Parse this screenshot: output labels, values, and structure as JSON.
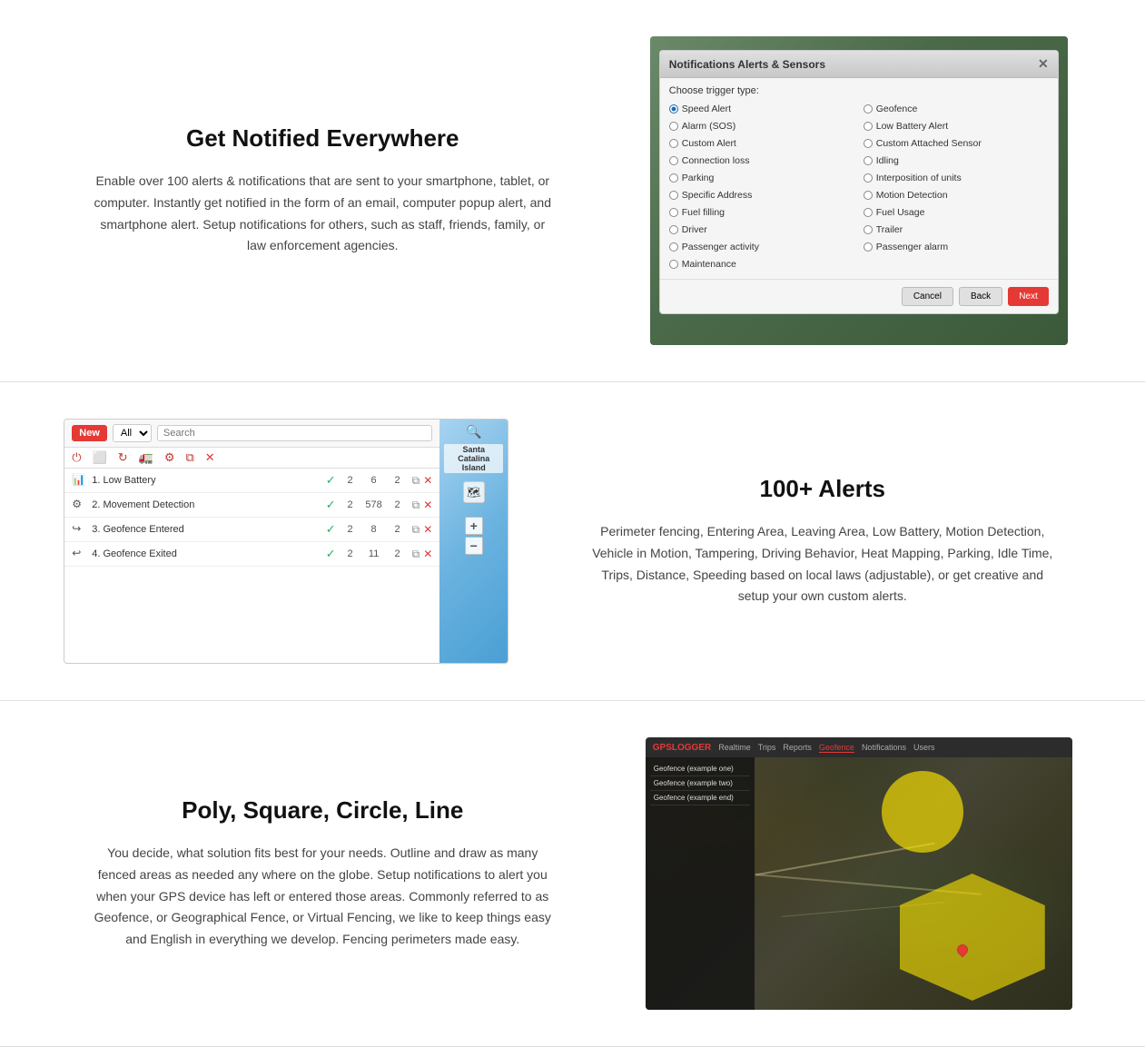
{
  "sections": [
    {
      "id": "notifications",
      "heading": "Get Notified Everywhere",
      "body": "Enable over 100 alerts & notifications that are sent to your smartphone, tablet, or computer. Instantly get notified in the form of an email, computer popup alert, and smartphone alert. Setup notifications for others, such as staff, friends, family, or law enforcement agencies.",
      "dialog": {
        "title": "Notifications Alerts & Sensors",
        "trigger_label": "Choose trigger type:",
        "options_left": [
          "Speed Alert",
          "Alarm (SOS)",
          "Custom Alert",
          "Connection loss",
          "Parking",
          "Specific Address",
          "Fuel filling",
          "Driver",
          "Passenger activity",
          "Maintenance"
        ],
        "options_right": [
          "Geofence",
          "Low Battery Alert",
          "Custom Attached Sensor",
          "Idling",
          "Interposition of units",
          "Motion Detection",
          "Fuel Usage",
          "Trailer",
          "Passenger alarm"
        ],
        "selected": "Speed Alert",
        "buttons": [
          "Cancel",
          "Back",
          "Next"
        ]
      }
    },
    {
      "id": "alerts",
      "heading": "100+ Alerts",
      "body": "Perimeter fencing, Entering Area, Leaving Area, Low Battery, Motion Detection, Vehicle in Motion, Tampering, Driving Behavior, Heat Mapping, Parking, Idle Time, Trips, Distance, Speeding based on local laws (adjustable), or get creative and setup your own custom alerts.",
      "list": {
        "new_label": "New",
        "filter_option": "All",
        "search_placeholder": "Search",
        "rows": [
          {
            "id": 1,
            "icon": "bar-chart",
            "name": "1. Low Battery",
            "active": true,
            "count1": 2,
            "count2": 6,
            "count3": 2
          },
          {
            "id": 2,
            "icon": "settings",
            "name": "2. Movement Detection",
            "active": true,
            "count1": 2,
            "count2": 578,
            "count3": 2
          },
          {
            "id": 3,
            "icon": "enter",
            "name": "3. Geofence Entered",
            "active": true,
            "count1": 2,
            "count2": 8,
            "count3": 2
          },
          {
            "id": 4,
            "icon": "exit",
            "name": "4. Geofence Exited",
            "active": true,
            "count1": 2,
            "count2": 11,
            "count3": 2
          }
        ]
      }
    },
    {
      "id": "geofence",
      "heading": "Poly, Square, Circle, Line",
      "body": "You decide, what solution fits best for your needs. Outline and draw as many fenced areas as needed any where on the globe. Setup notifications to alert you when your GPS device has left or entered those areas. Commonly referred to as Geofence, or Geographical Fence, or Virtual Fencing, we like to keep things easy and English in everything we develop. Fencing perimeters made easy.",
      "map": {
        "logo": "GPSLOGGER",
        "nav_items": [
          "Realtime",
          "Trips",
          "Reports",
          "Geofence",
          "Notifications",
          "Users"
        ],
        "active_nav": "Geofence",
        "list_items": [
          "Geofence (example one)",
          "Geofence (example two)",
          "Geofence (example end)"
        ]
      }
    }
  ]
}
